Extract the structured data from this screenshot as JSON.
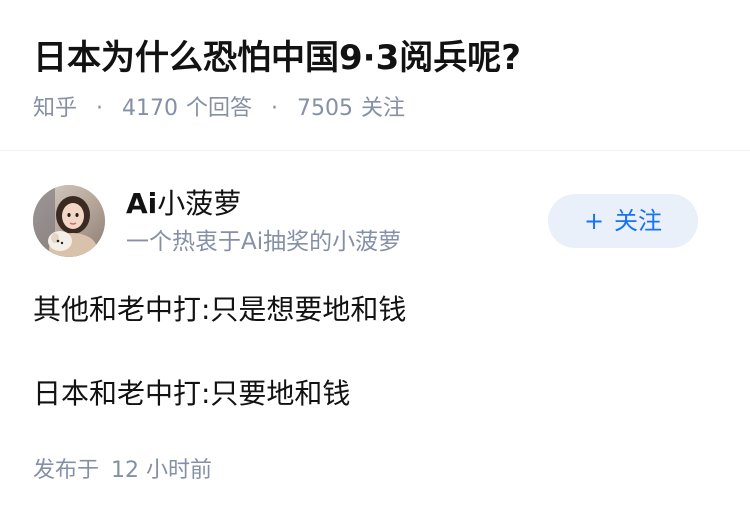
{
  "question": {
    "title": "日本为什么恐怕中国9·3阅兵呢?",
    "source": "知乎",
    "answer_count": "4170",
    "answer_label": "个回答",
    "follow_count": "7505",
    "follow_label": "关注"
  },
  "author": {
    "name_prefix": "Ai",
    "name_rest": "小菠萝",
    "bio": "一个热衷于Ai抽奖的小菠萝",
    "follow_button_plus": "+",
    "follow_button_label": "关注"
  },
  "answer": {
    "lines": [
      "其他和老中打:只是想要地和钱",
      "日本和老中打:只要地和钱"
    ],
    "published_label": "发布于",
    "published_time": "12 小时前"
  },
  "colors": {
    "accent": "#1772f6",
    "follow_button_bg": "#e9f0f9",
    "meta_text": "#8590a6"
  }
}
